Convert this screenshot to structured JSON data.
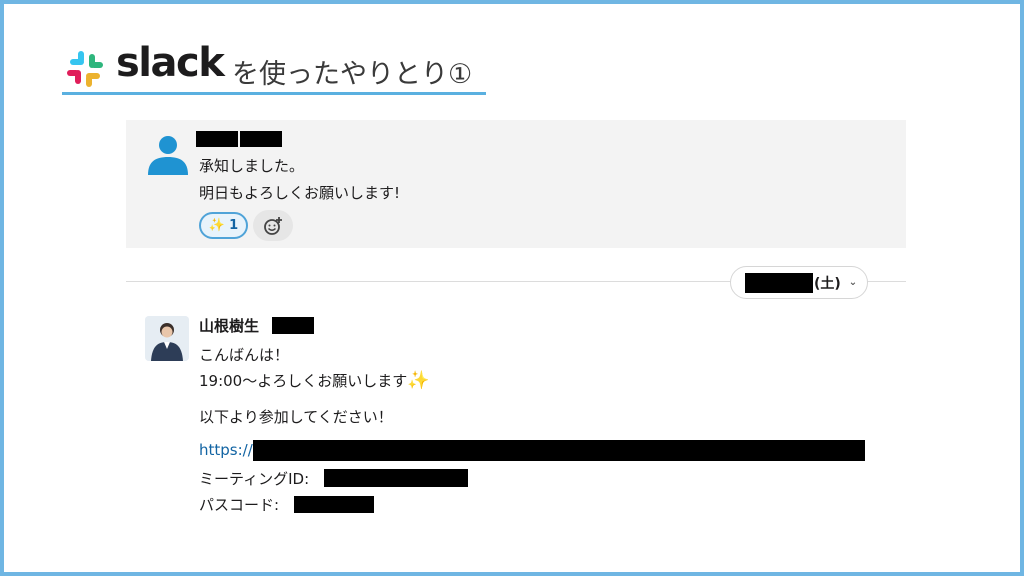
{
  "header": {
    "brand": "slack",
    "title": "を使ったやりとり①"
  },
  "top_message": {
    "line1": "承知しました。",
    "line2": "明日もよろしくお願いします!",
    "reaction_emoji": "✨",
    "reaction_count": "1",
    "add_reaction_icon": "add-emoji-icon"
  },
  "date_divider": {
    "suffix": "(土)",
    "chevron": "⌄"
  },
  "message": {
    "sender": "山根樹生",
    "line1": "こんばんは！",
    "line2": "19:00〜よろしくお願いします",
    "line2_emoji": "✨",
    "line3": "以下より参加してください！",
    "link_prefix": "https://",
    "meeting_label": "ミーティングID:",
    "pass_label": "パスコード:"
  },
  "colors": {
    "frame": "#6fb6e3",
    "link": "#1264a3",
    "underline": "#5ab0e0",
    "avatar": "#1f93d2"
  }
}
